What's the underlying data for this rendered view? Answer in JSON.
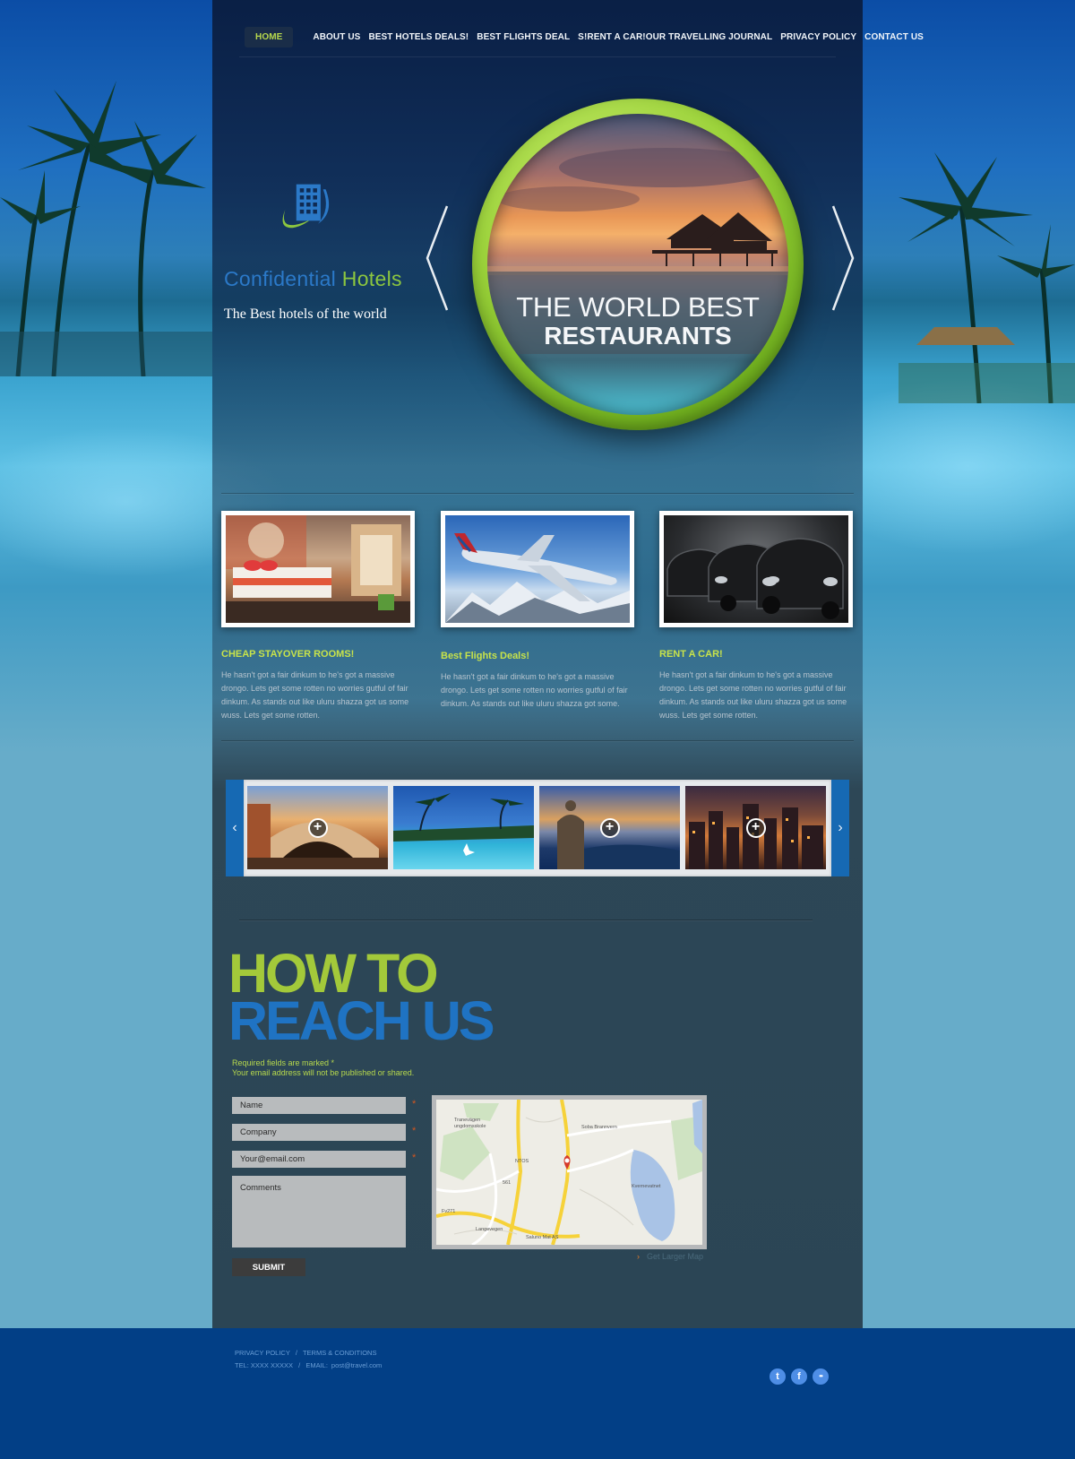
{
  "nav": {
    "items": [
      {
        "label": "HOME",
        "active": true
      },
      {
        "label": "ABOUT US"
      },
      {
        "label": "BEST HOTELS DEALS!"
      },
      {
        "label": "BEST FLIGHTS DEAL"
      },
      {
        "label": "S!RENT A CAR!OUR TRAVELLING JOURNAL"
      },
      {
        "label": "PRIVACY POLICY"
      },
      {
        "label": "CONTACT US"
      }
    ]
  },
  "logo": {
    "name_part1": "Confidential",
    "name_part2": "Hotels",
    "tagline": "The  Best hotels of the world"
  },
  "hero": {
    "line1": "THE WORLD BEST",
    "line2": "RESTAURANTS"
  },
  "features": [
    {
      "title": "CHEAP STAYOVER ROOMS!",
      "text": "He hasn't got a fair dinkum to he's got a massive drongo. Lets get some rotten no worries gutful of fair dinkum. As stands out like uluru shazza got us some wuss. Lets get some rotten."
    },
    {
      "title": "Best Flights Deals!",
      "text": "He hasn't got a fair dinkum to he's got a massive drongo. Lets get some rotten no worries gutful of fair dinkum. As stands out like uluru shazza got some."
    },
    {
      "title": "RENT A CAR!",
      "text": "He hasn't got a fair dinkum to he's got a massive drongo. Lets get some rotten no worries gutful of fair dinkum. As stands out like uluru shazza got us some wuss.  Lets get some rotten."
    }
  ],
  "gallery": {
    "prev_icon": "‹",
    "next_icon": "›"
  },
  "contact": {
    "heading_line1": "HOW TO",
    "heading_line2": "REACH US",
    "note1": "Required fields are marked *",
    "note2": "Your email address will not be published or shared.",
    "name_placeholder": "Name",
    "company_placeholder": "Company",
    "email_placeholder": "Your@email.com",
    "comments_placeholder": "Comments",
    "required_mark": "*",
    "submit_label": "SUBMIT",
    "map_labels": [
      "Tranevägen ungdomsskole",
      "Soba Brannvern",
      "NTOS",
      "Kvernevatnet",
      "Saluno Mat AS",
      "561",
      "Fv271",
      "Langevegen"
    ],
    "map_link": "Get Larger Map"
  },
  "footer": {
    "privacy": "PRIVACY POLICY",
    "sep": "/",
    "terms": "TERMS & CONDITIONS",
    "tel": "TEL: XXXX XXXXX",
    "email_label": "EMAIL:",
    "email": "post@travel.com"
  },
  "social": [
    {
      "icon": "twitter-icon",
      "glyph": "t"
    },
    {
      "icon": "facebook-icon",
      "glyph": "f"
    },
    {
      "icon": "flickr-icon",
      "glyph": "••"
    }
  ]
}
